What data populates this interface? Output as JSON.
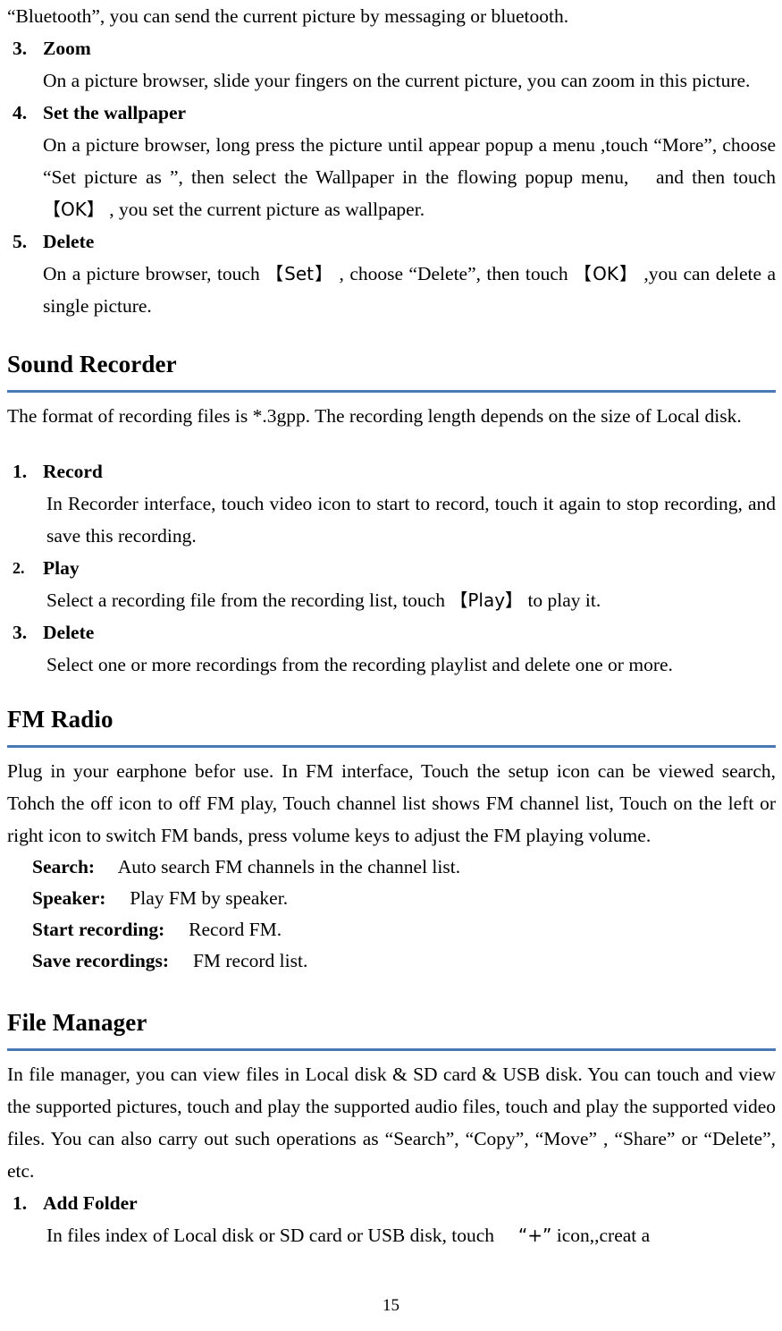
{
  "page": {
    "number": "15"
  },
  "gallery_section": {
    "intro_continuation": "“Bluetooth”, you can send the current picture by messaging or bluetooth.",
    "items": [
      {
        "marker": "3.",
        "title": "Zoom",
        "body": "On a picture browser, slide your fingers on the current picture, you can zoom in this picture."
      },
      {
        "marker": "4.",
        "title": "Set the wallpaper",
        "body_part1": "On a picture browser, long press the picture until appear popup a menu ,touch “More”, choose “Set picture as ”, then select the Wallpaper in the flowing popup menu,  and then touch ",
        "body_bracket1": "【OK】",
        "body_part2": " , you set the current picture as wallpaper."
      },
      {
        "marker": "5.",
        "title": "Delete",
        "body_part1": "On a picture browser, touch ",
        "body_bracket1": "【Set】",
        "body_part2": " , choose “Delete”, then touch ",
        "body_bracket2": "【OK】",
        "body_part3": " ,you can delete a single picture."
      }
    ]
  },
  "sound_recorder": {
    "heading": "Sound Recorder",
    "intro": "The format of recording files is *.3gpp. The recording length depends on the size of Local disk.",
    "items": [
      {
        "marker": "1.",
        "title": "Record",
        "body": "In Recorder interface, touch video icon to start to record, touch it again to stop recording, and save this recording."
      },
      {
        "marker": "2.",
        "title": "Play",
        "body_part1": "Select a recording file from the recording list, touch ",
        "body_bracket1": "【Play】",
        "body_part2": " to play it."
      },
      {
        "marker": "3.",
        "title": "Delete",
        "body": "Select one or more recordings from the recording playlist and delete one or more."
      }
    ]
  },
  "fm_radio": {
    "heading": "FM Radio",
    "intro": "Plug in your earphone befor use. In FM interface, Touch the setup icon can be viewed search, Tohch the off icon to off FM play, Touch channel list shows FM channel list, Touch on the left or right icon to switch FM bands, press volume keys to adjust the FM playing volume.",
    "definitions": [
      {
        "term": "Search:",
        "description": "  Auto search FM channels in the channel list."
      },
      {
        "term": "Speaker:",
        "description": "  Play FM by speaker."
      },
      {
        "term": "Start recording:",
        "description": "  Record FM."
      },
      {
        "term": "Save recordings:",
        "description": "  FM record list."
      }
    ]
  },
  "file_manager": {
    "heading": "File Manager",
    "intro": "In file manager, you can view files in Local disk & SD card & USB disk. You can touch and view the supported pictures, touch and play the supported audio files, touch and play the supported video files. You can also carry out such operations as “Search”, “Copy”, “Move” , “Share” or “Delete”, etc.",
    "items": [
      {
        "marker": "1.",
        "title": "Add Folder",
        "body_part1": "In files index of Local disk or SD card or USB disk, touch  ",
        "body_quote": "“+”",
        "body_part2": " icon,,creat a"
      }
    ]
  }
}
